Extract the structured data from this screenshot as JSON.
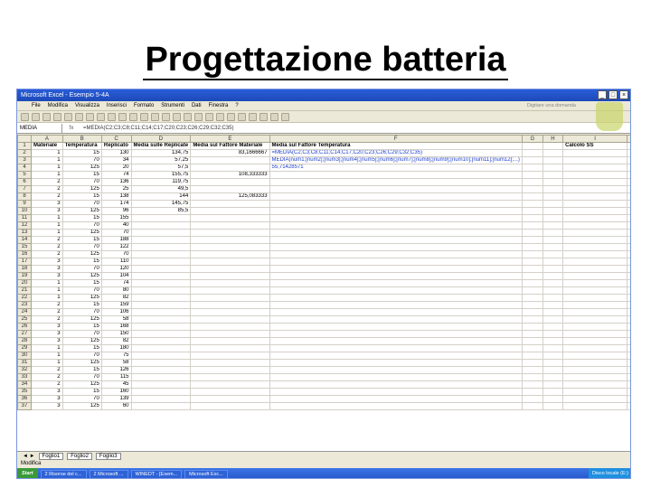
{
  "slide_title": "Progettazione batteria",
  "window": {
    "title": "Microsoft Excel - Esempio 5-4A",
    "question": "Digitare una domanda"
  },
  "menu": [
    "File",
    "Modifica",
    "Visualizza",
    "Inserisci",
    "Formato",
    "Strumenti",
    "Dati",
    "Finestra",
    "?"
  ],
  "formula_bar": {
    "name_box": "MEDIA",
    "formula": "=MEDIA(C2;C3;C8;C11;C14;C17;C20;C23;C26;C29;C32;C35)"
  },
  "columns": [
    "A",
    "B",
    "C",
    "D",
    "E",
    "F",
    "G",
    "H",
    "I"
  ],
  "headers": [
    "Materiale",
    "Temperatura",
    "Replicato",
    "Media sulle Replicate",
    "Media sul Fattore Materiale",
    "Media sul Fattore Temperatura",
    "",
    "",
    "Calcolo SS"
  ],
  "rows": [
    [
      "1",
      "15",
      "130",
      "134,75",
      "83,1666667",
      "=MEDIA(C2;C3;C8;C11;C14;C17;C20;C23;C26;C29;C32;C35)",
      "",
      "",
      ""
    ],
    [
      "1",
      "70",
      "34",
      "57,25",
      "",
      "MEDIA(num1;[num2];[num3];[num4];[num5];[num6];[num7];[num8];[num9];[num10];[num11];[num12];...)",
      "",
      "",
      ""
    ],
    [
      "1",
      "125",
      "20",
      "57,5",
      "",
      "55,71428571",
      "",
      "",
      ""
    ],
    [
      "1",
      "15",
      "74",
      "155,75",
      "108,333333",
      "",
      "",
      "",
      ""
    ],
    [
      "2",
      "70",
      "136",
      "119,75",
      "",
      "",
      "",
      "",
      ""
    ],
    [
      "2",
      "125",
      "25",
      "49,5",
      "",
      "",
      "",
      "",
      ""
    ],
    [
      "2",
      "15",
      "138",
      "144",
      "125,083333",
      "",
      "",
      "",
      ""
    ],
    [
      "3",
      "70",
      "174",
      "145,75",
      "",
      "",
      "",
      "",
      ""
    ],
    [
      "3",
      "125",
      "96",
      "85,5",
      "",
      "",
      "",
      "",
      ""
    ],
    [
      "1",
      "15",
      "155",
      "",
      "",
      "",
      "",
      "",
      ""
    ],
    [
      "1",
      "70",
      "40",
      "",
      "",
      "",
      "",
      "",
      ""
    ],
    [
      "1",
      "125",
      "70",
      "",
      "",
      "",
      "",
      "",
      ""
    ],
    [
      "2",
      "15",
      "188",
      "",
      "",
      "",
      "",
      "",
      ""
    ],
    [
      "2",
      "70",
      "122",
      "",
      "",
      "",
      "",
      "",
      ""
    ],
    [
      "2",
      "125",
      "70",
      "",
      "",
      "",
      "",
      "",
      ""
    ],
    [
      "3",
      "15",
      "110",
      "",
      "",
      "",
      "",
      "",
      ""
    ],
    [
      "3",
      "70",
      "120",
      "",
      "",
      "",
      "",
      "",
      ""
    ],
    [
      "3",
      "125",
      "104",
      "",
      "",
      "",
      "",
      "",
      ""
    ],
    [
      "1",
      "15",
      "74",
      "",
      "",
      "",
      "",
      "",
      ""
    ],
    [
      "1",
      "70",
      "80",
      "",
      "",
      "",
      "",
      "",
      ""
    ],
    [
      "1",
      "125",
      "82",
      "",
      "",
      "",
      "",
      "",
      ""
    ],
    [
      "2",
      "15",
      "159",
      "",
      "",
      "",
      "",
      "",
      ""
    ],
    [
      "2",
      "70",
      "106",
      "",
      "",
      "",
      "",
      "",
      ""
    ],
    [
      "2",
      "125",
      "58",
      "",
      "",
      "",
      "",
      "",
      ""
    ],
    [
      "3",
      "15",
      "168",
      "",
      "",
      "",
      "",
      "",
      ""
    ],
    [
      "3",
      "70",
      "150",
      "",
      "",
      "",
      "",
      "",
      ""
    ],
    [
      "3",
      "125",
      "82",
      "",
      "",
      "",
      "",
      "",
      ""
    ],
    [
      "1",
      "15",
      "180",
      "",
      "",
      "",
      "",
      "",
      ""
    ],
    [
      "1",
      "70",
      "75",
      "",
      "",
      "",
      "",
      "",
      ""
    ],
    [
      "1",
      "125",
      "58",
      "",
      "",
      "",
      "",
      "",
      ""
    ],
    [
      "2",
      "15",
      "126",
      "",
      "",
      "",
      "",
      "",
      ""
    ],
    [
      "2",
      "70",
      "115",
      "",
      "",
      "",
      "",
      "",
      ""
    ],
    [
      "2",
      "125",
      "45",
      "",
      "",
      "",
      "",
      "",
      ""
    ],
    [
      "3",
      "15",
      "160",
      "",
      "",
      "",
      "",
      "",
      ""
    ],
    [
      "3",
      "70",
      "139",
      "",
      "",
      "",
      "",
      "",
      ""
    ],
    [
      "3",
      "125",
      "60",
      "",
      "",
      "",
      "",
      "",
      ""
    ]
  ],
  "sheet_tabs": [
    "Foglio1",
    "Foglio2",
    "Foglio3"
  ],
  "status": "Modifica",
  "taskbar": {
    "start": "Start",
    "tasks": [
      "2 Risorse del c...",
      "2 Microsoft ...",
      "WINEDT - [Esem...",
      "Microsoft Exc..."
    ],
    "tray": "Disco locale (E:)"
  }
}
